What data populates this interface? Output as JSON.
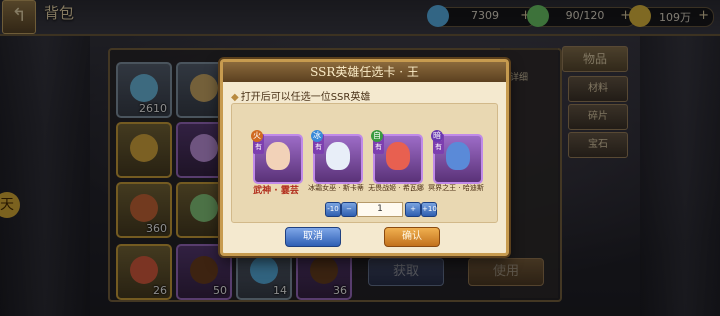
{
  "header": {
    "back_icon": "back-arrow-icon",
    "title": "背包"
  },
  "resources": [
    {
      "name": "diamond",
      "icon": "diamond-icon",
      "color": "#5bb8f0",
      "value": "7309",
      "plus": "+"
    },
    {
      "name": "stamina",
      "icon": "bottle-icon",
      "color": "#6fd06a",
      "value": "90/120",
      "plus": "+"
    },
    {
      "name": "gold",
      "icon": "coin-icon",
      "color": "#e8c040",
      "value": "109万",
      "plus": "+"
    }
  ],
  "inventory": [
    {
      "count": "2610",
      "style": "normal",
      "color": "#6fc2e8"
    },
    {
      "count": "",
      "style": "normal",
      "color": "#d4b06a"
    },
    {
      "count": "",
      "style": "gold",
      "color": "#e0b040"
    },
    {
      "count": "",
      "style": "purple",
      "color": "#c89ae8"
    },
    {
      "count": "360",
      "style": "gold",
      "color": "#d06a3a"
    },
    {
      "count": "",
      "style": "gold",
      "color": "#8ad080"
    },
    {
      "count": "26",
      "style": "gold",
      "color": "#e06040"
    },
    {
      "count": "50",
      "style": "purple",
      "color": "#704020"
    },
    {
      "count": "14",
      "style": "normal",
      "color": "#5ab4e8"
    },
    {
      "count": "36",
      "style": "purple",
      "color": "#6a4020"
    }
  ],
  "side_tabs": [
    {
      "label": "物品",
      "active": true
    },
    {
      "label": "材料",
      "active": false
    },
    {
      "label": "碎片",
      "active": false
    },
    {
      "label": "宝石",
      "active": false
    }
  ],
  "detail": {
    "hint": "详细",
    "receive_label": "获取",
    "use_label": "使用"
  },
  "dialog": {
    "title": "SSR英雄任选卡 · 王",
    "subtitle": "打开后可以任选一位SSR英雄",
    "heroes": [
      {
        "name": "武神 · 霎芸",
        "tag": "稀有",
        "element": "火",
        "elem_color": "#d06a20",
        "face": "#f2d2b8",
        "selected": true
      },
      {
        "name": "冰霜女巫 · 斯卡蒂",
        "tag": "稀有",
        "element": "冰",
        "elem_color": "#3a8ad8",
        "face": "#e8eef8",
        "selected": false
      },
      {
        "name": "无畏战姬 · 希瓦娜",
        "tag": "稀有",
        "element": "自",
        "elem_color": "#3a9a40",
        "face": "#e86050",
        "selected": false
      },
      {
        "name": "冥界之王 · 哈迪斯",
        "tag": "稀有",
        "element": "暗",
        "elem_color": "#6a3ab0",
        "face": "#5a8ad8",
        "selected": false
      }
    ],
    "stepper": {
      "minus10": "-10",
      "minus": "−",
      "value": "1",
      "plus": "+",
      "plus10": "+10"
    },
    "cancel_label": "取消",
    "confirm_label": "确认"
  },
  "left_badge": "天"
}
